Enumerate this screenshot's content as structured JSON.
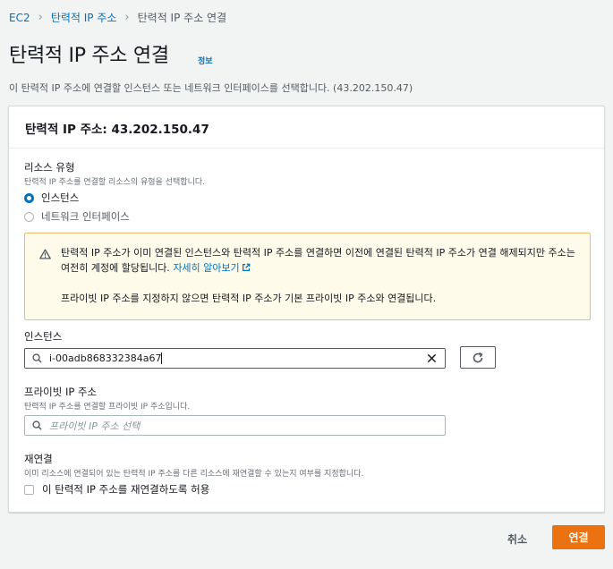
{
  "breadcrumb": {
    "items": [
      "EC2",
      "탄력적 IP 주소"
    ],
    "current": "탄력적 IP 주소 연결"
  },
  "page": {
    "title": "탄력적 IP 주소 연결",
    "info_link": "정보",
    "description": "이 탄력적 IP 주소에 연결할 인스턴스 또는 네트워크 인터페이스를 선택합니다. (43.202.150.47)"
  },
  "panel": {
    "title": "탄력적 IP 주소: 43.202.150.47"
  },
  "resource_type": {
    "label": "리소스 유형",
    "description": "탄력적 IP 주소를 연결할 리소스의 유형을 선택합니다.",
    "options": [
      {
        "label": "인스턴스",
        "selected": true
      },
      {
        "label": "네트워크 인터페이스",
        "selected": false
      }
    ]
  },
  "alert": {
    "icon": "warning-icon",
    "line1": "탄력적 IP 주소가 이미 연결된 인스턴스와 탄력적 IP 주소를 연결하면 이전에 연결된 탄력적 IP 주소가 연결 해제되지만 주소는 여전히 계정에 할당됩니다.",
    "learn_more": "자세히 알아보기",
    "line2": "프라이빗 IP 주소를 지정하지 않으면 탄력적 IP 주소가 기본 프라이빗 IP 주소와 연결됩니다.",
    "border_color": "#e4c06b",
    "background_color": "#fffbea"
  },
  "instance": {
    "label": "인스턴스",
    "value": "i-00adb868332384a67"
  },
  "private_ip": {
    "label": "프라이빗 IP 주소",
    "description": "탄력적 IP 주소를 연결할 프라이빗 IP 주소입니다.",
    "placeholder": "프라이빗 IP 주소 선택"
  },
  "reassociation": {
    "label": "재연결",
    "description": "이미 리소스에 연결되어 있는 탄력적 IP 주소를 다른 리소스에 재연결할 수 있는지 여부를 지정합니다.",
    "checkbox_label": "이 탄력적 IP 주소를 재연결하도록 허용",
    "checked": false
  },
  "footer": {
    "cancel": "취소",
    "submit": "연결"
  },
  "colors": {
    "link": "#0073bb",
    "primary": "#ec7211",
    "page_bg": "#f2f3f3"
  }
}
